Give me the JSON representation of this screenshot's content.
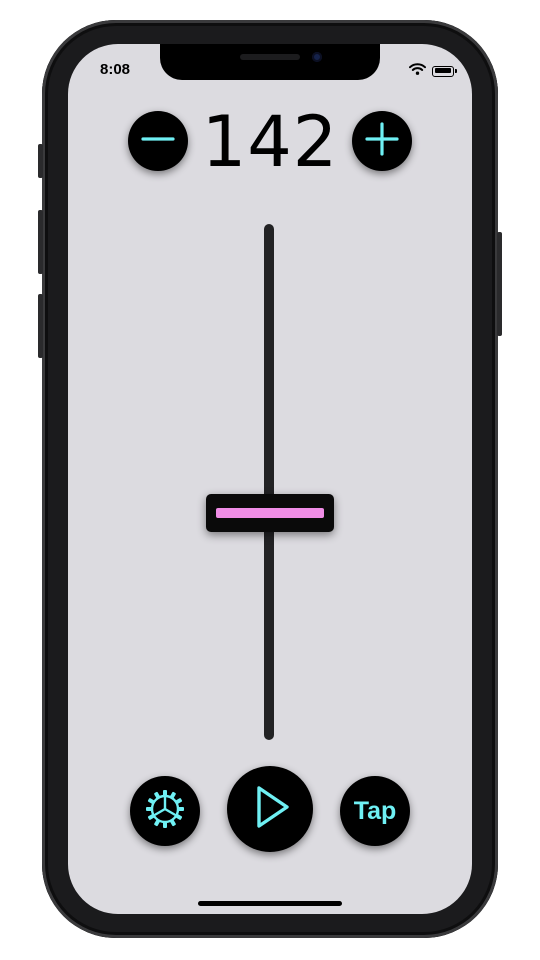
{
  "status_bar": {
    "time": "8:08",
    "wifi_icon": "wifi-icon",
    "battery_icon": "battery-icon"
  },
  "tempo": {
    "value": "142",
    "decrease_icon": "minus-icon",
    "increase_icon": "plus-icon"
  },
  "tempo_slider": {
    "position_fraction": 0.56
  },
  "controls": {
    "settings_icon": "gear-icon",
    "play_icon": "play-icon",
    "tap_label": "Tap"
  },
  "colors": {
    "accent": "#6ff0f4",
    "thumb_accent": "#f08de6",
    "background": "#dcdbe0"
  }
}
